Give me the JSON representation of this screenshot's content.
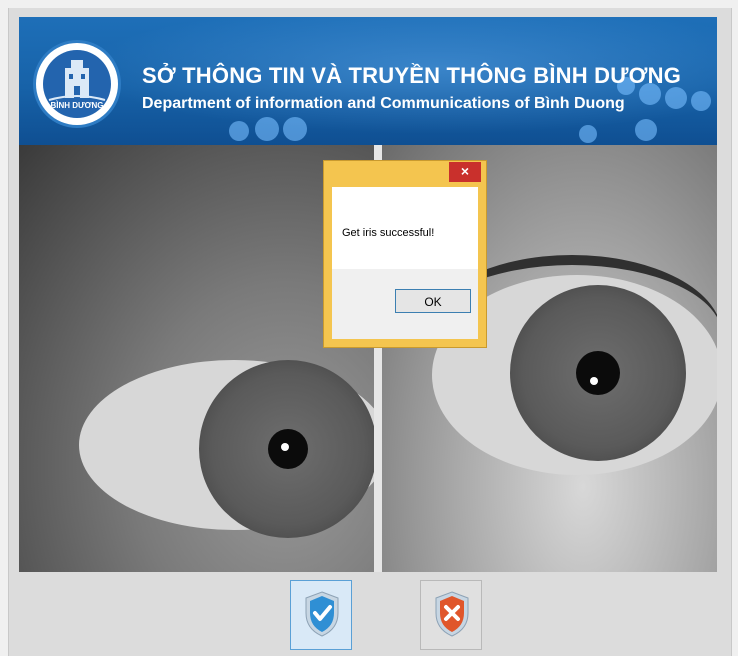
{
  "header": {
    "title_vi": "SỞ THÔNG TIN VÀ TRUYỀN THÔNG BÌNH DƯƠNG",
    "title_en": "Department of information and Communications of Bình Duong",
    "logo_text": "BÌNH DƯƠNG"
  },
  "dialog": {
    "close_label": "×",
    "message": "Get iris successful!",
    "ok_label": "OK"
  },
  "actions": {
    "confirm_icon": "check-shield-icon",
    "cancel_icon": "x-shield-icon"
  },
  "colors": {
    "banner": "#1762a8",
    "dialog_frame": "#f4c54f",
    "close": "#c9302c",
    "confirm": "#2f8fd4",
    "cancel": "#e0562b"
  }
}
